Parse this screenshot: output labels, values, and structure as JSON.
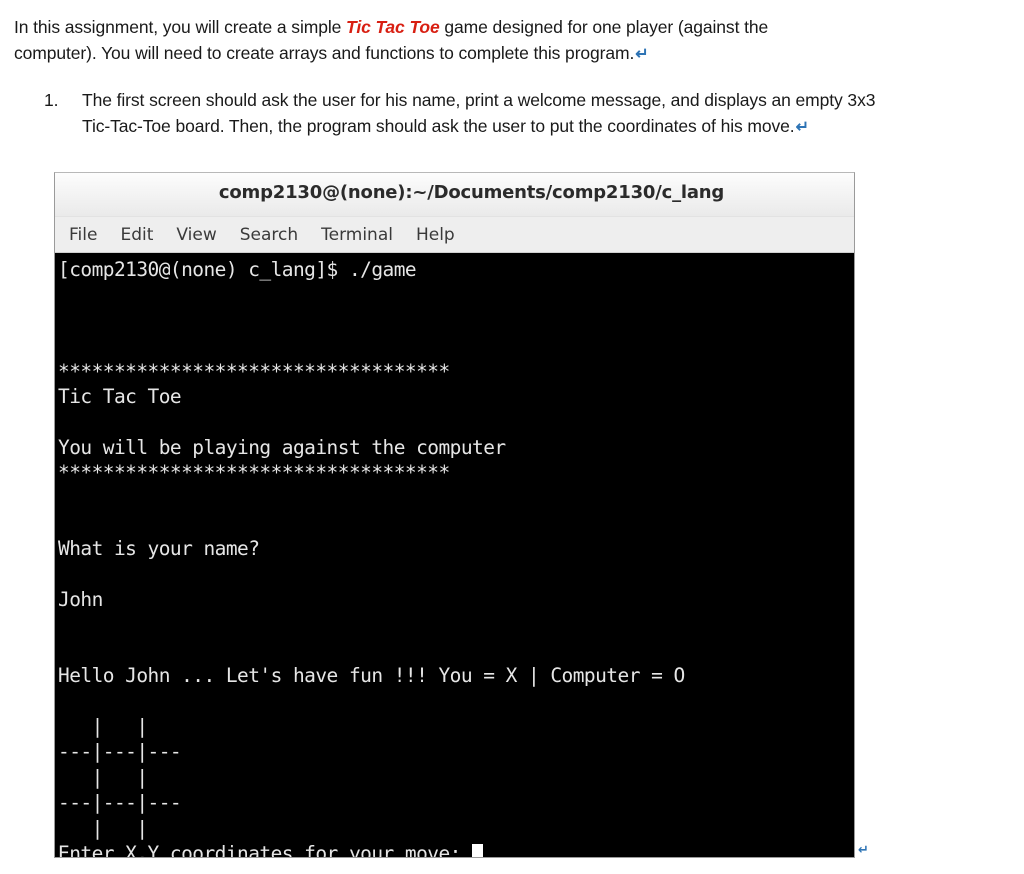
{
  "document": {
    "paragraph": {
      "before_emphasis": "In this assignment, you will create a simple ",
      "emphasis": "Tic Tac Toe",
      "after_emphasis": " game designed for one player (against the computer). You will need to create arrays and functions to complete this program.",
      "pilcrow": "↵"
    },
    "list": [
      {
        "number": "1.",
        "text": "The first screen should ask the user for his name, print a welcome message, and displays an empty 3x3 Tic-Tac-Toe board. Then, the program should ask the user to put the coordinates of his move.",
        "pilcrow": "↵"
      }
    ],
    "trailing_mark": "↵"
  },
  "terminal": {
    "title": "comp2130@(none):~/Documents/comp2130/c_lang",
    "menu": [
      {
        "label": "File"
      },
      {
        "label": "Edit"
      },
      {
        "label": "View"
      },
      {
        "label": "Search"
      },
      {
        "label": "Terminal"
      },
      {
        "label": "Help"
      }
    ],
    "lines": [
      "[comp2130@(none) c_lang]$ ./game",
      "",
      "",
      "",
      "***********************************",
      "Tic Tac Toe",
      "",
      "You will be playing against the computer",
      "***********************************",
      "",
      "",
      "What is your name?",
      "",
      "John",
      "",
      "",
      "Hello John ... Let's have fun !!! You = X | Computer = O",
      "",
      "   |   |   ",
      "---|---|---",
      "   |   |   ",
      "---|---|---",
      "   |   |   "
    ],
    "prompt_line": "Enter X,Y coordinates for your move: ",
    "cursor": "block",
    "colors": {
      "background": "#000000",
      "foreground": "#e6e6e6",
      "titlebar": "#f4f4f4",
      "menubar": "#eeeeee"
    }
  }
}
